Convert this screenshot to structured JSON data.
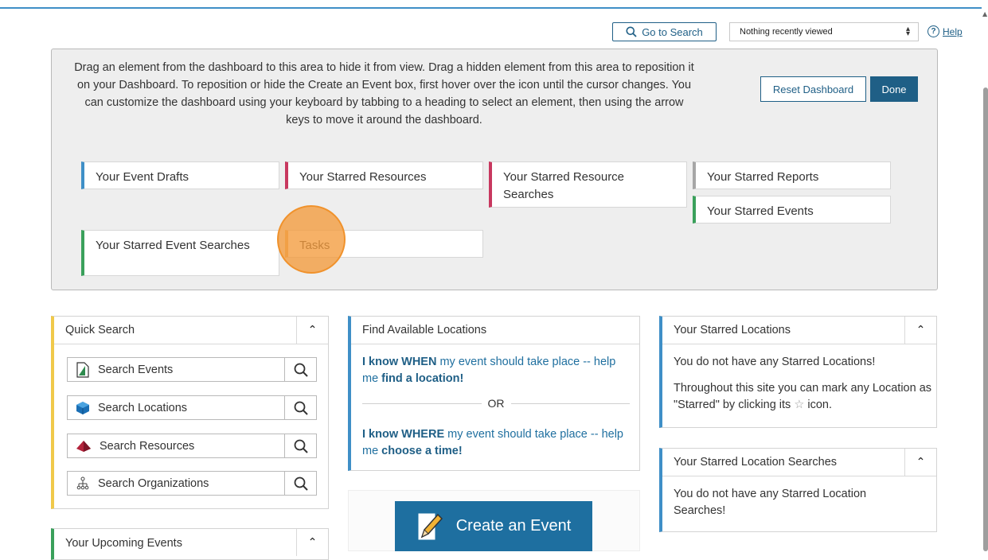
{
  "top": {
    "goto_search": "Go to Search",
    "recent_viewed": "Nothing recently viewed",
    "help": "Help"
  },
  "hidden_area": {
    "instructions": "Drag an element from the dashboard to this area to hide it from view. Drag a hidden element from this area to reposition it on your Dashboard.  To reposition or hide the Create an Event box, first hover over the icon until the cursor changes.  You can customize the dashboard using your keyboard by tabbing to a heading to select an element, then using the arrow keys to move it around the dashboard.",
    "reset_button": "Reset Dashboard",
    "done_button": "Done",
    "tiles": [
      "Your Event Drafts",
      "Your Starred Resources",
      "Your Starred Resource Searches",
      "Your Starred Reports",
      "Your Starred Events",
      "Your Starred Event Searches",
      "Tasks"
    ]
  },
  "quick_search": {
    "title": "Quick Search",
    "items": [
      "Search Events",
      "Search Locations",
      "Search Resources",
      "Search Organizations"
    ]
  },
  "find_locations": {
    "title": "Find Available Locations",
    "when_prefix": "I know WHEN",
    "when_middle": " my event should take place -- help me ",
    "when_link": "find a location!",
    "or": "OR",
    "where_prefix": "I know WHERE",
    "where_middle": " my event should take place -- help me ",
    "where_link": "choose a time!"
  },
  "starred_locations": {
    "title": "Your Starred Locations",
    "empty": "You do not have any Starred Locations!",
    "hint_a": "Throughout this site you can mark any Location as \"Starred\" by clicking its ",
    "hint_b": " icon."
  },
  "starred_location_searches": {
    "title": "Your Starred Location Searches",
    "empty": "You do not have any Starred Location Searches!"
  },
  "upcoming_events": {
    "title": "Your Upcoming Events"
  },
  "create_event": {
    "label": "Create an Event"
  },
  "colors": {
    "accent": "#1f5f86",
    "click_marker": "#f49b3c"
  }
}
